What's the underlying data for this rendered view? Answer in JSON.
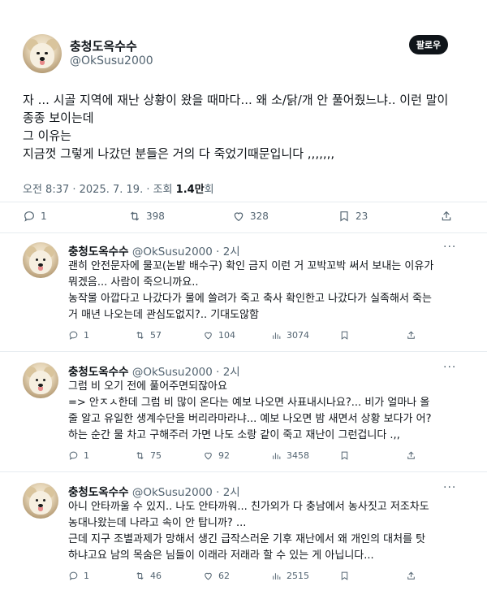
{
  "main_post": {
    "display_name": "충청도옥수수",
    "handle": "@OkSusu2000",
    "follow_label": "팔로우",
    "text_lines": [
      "자 ... 시골 지역에 재난 상황이 왔을 때마다... 왜 소/닭/개 안 풀어줬느냐.. 이런 말이",
      "종종 보이는데",
      "그 이유는",
      "지금껏 그렇게 나갔던 분들은 거의 다 죽었기때문입니다 ,,,,,,,"
    ],
    "timestamp": "오전 8:37 · 2025. 7. 19. · 조회",
    "views": "1.4만",
    "views_suffix": "회",
    "stats": {
      "replies": "1",
      "reposts": "398",
      "likes": "328",
      "bookmarks": "23"
    }
  },
  "replies": [
    {
      "display_name": "충청도옥수수",
      "handle": "@OkSusu2000",
      "time": "2시",
      "lines": [
        "괜히 안전문자에 물꼬(논밭 배수구) 확인 금지 이런 거 꼬박꼬박 써서 보내는 이유가",
        "뭐겠음... 사람이 죽으니까요..",
        "농작물 아깝다고 나갔다가 물에 쓸려가 죽고 축사 확인한고 나갔다가 실족해서 죽는",
        "거 매년 나오는데 관심도없지?.. 기대도않함"
      ],
      "stats": {
        "replies": "1",
        "reposts": "57",
        "likes": "104",
        "views": "3074"
      }
    },
    {
      "display_name": "충청도옥수수",
      "handle": "@OkSusu2000",
      "time": "2시",
      "lines": [
        "그럼 비 오기 전에 풀어주면되잖아요",
        "=> 안ㅈㅅ한데 그럼 비 많이 온다는 예보 나오면 사표내시나요?... 비가 얼마나 올",
        "줄 알고 유일한 생계수단을 버리라마라냐... 예보 나오면 밤 새면서 상황 보다가 어?",
        "하는 순간 물 차고 구해주러 가면 나도 소랑 같이 죽고 재난이 그런겁니다 .,,"
      ],
      "stats": {
        "replies": "1",
        "reposts": "75",
        "likes": "92",
        "views": "3458"
      }
    },
    {
      "display_name": "충청도옥수수",
      "handle": "@OkSusu2000",
      "time": "2시",
      "lines": [
        "아니 안타까울 수 있지.. 나도 안타까워... 친가외가 다 충남에서 농사짓고 저조차도",
        "농대나왔는데 나라고 속이 안 탑니까? ...",
        "근데 지구 조별과제가 망해서 생긴 급작스러운 기후 재난에서 왜 개인의 대처를 탓",
        "하냐고요 남의 목숨은 님들이 이래라 저래라 할 수 있는 게 아닙니다..."
      ],
      "stats": {
        "replies": "1",
        "reposts": "46",
        "likes": "62",
        "views": "2515"
      }
    }
  ],
  "more_glyph": "···",
  "icons": [
    "reply-icon",
    "repost-icon",
    "like-icon",
    "bookmark-icon",
    "share-icon",
    "views-icon"
  ]
}
